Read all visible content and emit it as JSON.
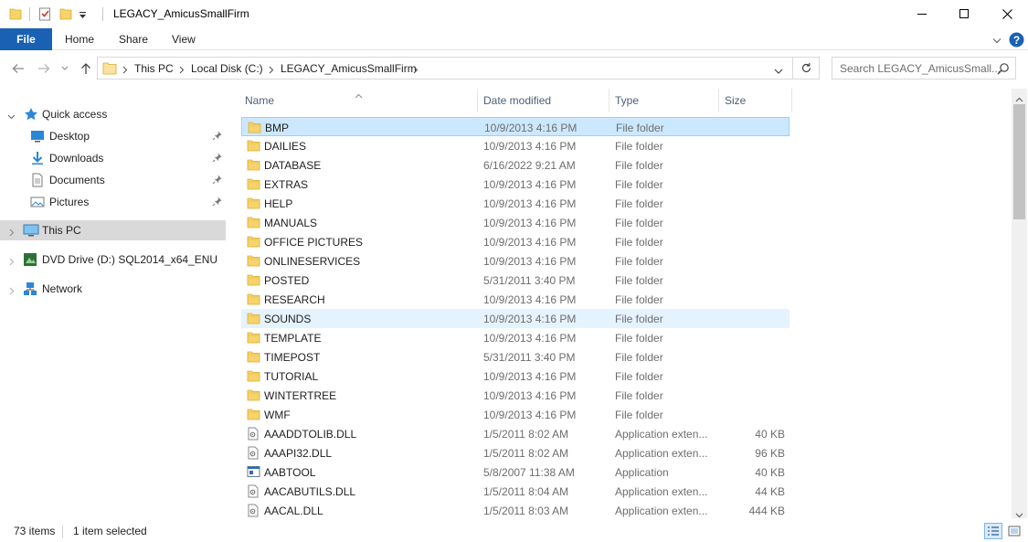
{
  "window": {
    "title": "LEGACY_AmicusSmallFirm",
    "minimize_label": "—",
    "maximize_label": "☐",
    "close_label": "✕"
  },
  "ribbon": {
    "tabs": [
      "File",
      "Home",
      "Share",
      "View"
    ],
    "help_label": "?"
  },
  "address": {
    "segments": [
      "This PC",
      "Local Disk (C:)",
      "LEGACY_AmicusSmallFirm"
    ]
  },
  "search": {
    "placeholder": "Search LEGACY_AmicusSmall..."
  },
  "nav": {
    "quick_access": "Quick access",
    "pinned": [
      {
        "label": "Desktop",
        "icon": "desktop-icon"
      },
      {
        "label": "Downloads",
        "icon": "downloads-icon"
      },
      {
        "label": "Documents",
        "icon": "documents-icon"
      },
      {
        "label": "Pictures",
        "icon": "pictures-icon"
      }
    ],
    "this_pc": "This PC",
    "dvd": "DVD Drive (D:) SQL2014_x64_ENU",
    "network": "Network"
  },
  "columns": {
    "name": "Name",
    "date": "Date modified",
    "type": "Type",
    "size": "Size"
  },
  "files": [
    {
      "name": "BMP",
      "date": "10/9/2013 4:16 PM",
      "type": "File folder",
      "size": "",
      "kind": "folder",
      "state": "selected"
    },
    {
      "name": "DAILIES",
      "date": "10/9/2013 4:16 PM",
      "type": "File folder",
      "size": "",
      "kind": "folder",
      "state": ""
    },
    {
      "name": "DATABASE",
      "date": "6/16/2022 9:21 AM",
      "type": "File folder",
      "size": "",
      "kind": "folder",
      "state": ""
    },
    {
      "name": "EXTRAS",
      "date": "10/9/2013 4:16 PM",
      "type": "File folder",
      "size": "",
      "kind": "folder",
      "state": ""
    },
    {
      "name": "HELP",
      "date": "10/9/2013 4:16 PM",
      "type": "File folder",
      "size": "",
      "kind": "folder",
      "state": ""
    },
    {
      "name": "MANUALS",
      "date": "10/9/2013 4:16 PM",
      "type": "File folder",
      "size": "",
      "kind": "folder",
      "state": ""
    },
    {
      "name": "OFFICE PICTURES",
      "date": "10/9/2013 4:16 PM",
      "type": "File folder",
      "size": "",
      "kind": "folder",
      "state": ""
    },
    {
      "name": "ONLINESERVICES",
      "date": "10/9/2013 4:16 PM",
      "type": "File folder",
      "size": "",
      "kind": "folder",
      "state": ""
    },
    {
      "name": "POSTED",
      "date": "5/31/2011 3:40 PM",
      "type": "File folder",
      "size": "",
      "kind": "folder",
      "state": ""
    },
    {
      "name": "RESEARCH",
      "date": "10/9/2013 4:16 PM",
      "type": "File folder",
      "size": "",
      "kind": "folder",
      "state": ""
    },
    {
      "name": "SOUNDS",
      "date": "10/9/2013 4:16 PM",
      "type": "File folder",
      "size": "",
      "kind": "folder",
      "state": "hover"
    },
    {
      "name": "TEMPLATE",
      "date": "10/9/2013 4:16 PM",
      "type": "File folder",
      "size": "",
      "kind": "folder",
      "state": ""
    },
    {
      "name": "TIMEPOST",
      "date": "5/31/2011 3:40 PM",
      "type": "File folder",
      "size": "",
      "kind": "folder",
      "state": ""
    },
    {
      "name": "TUTORIAL",
      "date": "10/9/2013 4:16 PM",
      "type": "File folder",
      "size": "",
      "kind": "folder",
      "state": ""
    },
    {
      "name": "WINTERTREE",
      "date": "10/9/2013 4:16 PM",
      "type": "File folder",
      "size": "",
      "kind": "folder",
      "state": ""
    },
    {
      "name": "WMF",
      "date": "10/9/2013 4:16 PM",
      "type": "File folder",
      "size": "",
      "kind": "folder",
      "state": ""
    },
    {
      "name": "AAADDTOLIB.DLL",
      "date": "1/5/2011 8:02 AM",
      "type": "Application exten...",
      "size": "40 KB",
      "kind": "dll",
      "state": ""
    },
    {
      "name": "AAAPI32.DLL",
      "date": "1/5/2011 8:02 AM",
      "type": "Application exten...",
      "size": "96 KB",
      "kind": "dll",
      "state": ""
    },
    {
      "name": "AABTOOL",
      "date": "5/8/2007 11:38 AM",
      "type": "Application",
      "size": "40 KB",
      "kind": "exe",
      "state": ""
    },
    {
      "name": "AACABUTILS.DLL",
      "date": "1/5/2011 8:04 AM",
      "type": "Application exten...",
      "size": "44 KB",
      "kind": "dll",
      "state": ""
    },
    {
      "name": "AACAL.DLL",
      "date": "1/5/2011 8:03 AM",
      "type": "Application exten...",
      "size": "444 KB",
      "kind": "dll",
      "state": ""
    }
  ],
  "status": {
    "count": "73 items",
    "selection": "1 item selected"
  },
  "colors": {
    "accent": "#1a61b3",
    "folder": "#f6d36b",
    "selection": "#cce8ff",
    "selection_border": "#99d1ff",
    "hover": "#e5f3ff"
  }
}
